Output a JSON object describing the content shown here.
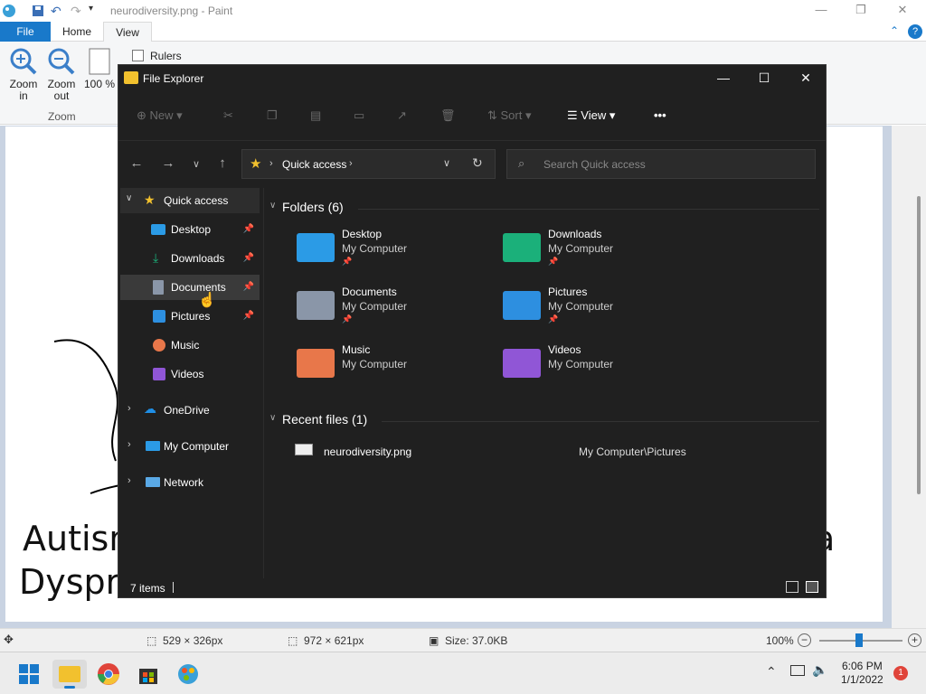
{
  "paint": {
    "title": "neurodiversity.png - Paint",
    "tabs": [
      "File",
      "Home",
      "View"
    ],
    "ribbon": {
      "zoom_in": "Zoom in",
      "zoom_out": "Zoom out",
      "hundred": "100 %",
      "rulers": "Rulers",
      "group_zoom": "Zoom"
    },
    "canvas_text_1": "Autism",
    "canvas_text_2": "Dyspra",
    "canvas_text_3": "a",
    "status": {
      "selection": "529 × 326px",
      "image_size": "972 × 621px",
      "file_size": "Size: 37.0KB",
      "zoom": "100%"
    }
  },
  "explorer": {
    "title": "File Explorer",
    "command_bar": {
      "new": "New",
      "sort": "Sort",
      "view": "View",
      "more": "•••"
    },
    "address": "Quick access",
    "search_placeholder": "Search Quick access",
    "sidebar": [
      {
        "label": "Quick access",
        "icon": "star-icon"
      },
      {
        "label": "Desktop",
        "icon": "desktop-icon"
      },
      {
        "label": "Downloads",
        "icon": "download-icon"
      },
      {
        "label": "Documents",
        "icon": "document-icon"
      },
      {
        "label": "Pictures",
        "icon": "pictures-icon"
      },
      {
        "label": "Music",
        "icon": "music-icon"
      },
      {
        "label": "Videos",
        "icon": "videos-icon"
      },
      {
        "label": "OneDrive",
        "icon": "cloud-icon"
      },
      {
        "label": "My Computer",
        "icon": "computer-icon"
      },
      {
        "label": "Network",
        "icon": "network-icon"
      }
    ],
    "folders_header": "Folders (6)",
    "folders": [
      {
        "name": "Desktop",
        "sub": "My Computer",
        "color": "#2b9be6"
      },
      {
        "name": "Downloads",
        "sub": "My Computer",
        "color": "#1bb07a"
      },
      {
        "name": "Documents",
        "sub": "My Computer",
        "color": "#8a96a8"
      },
      {
        "name": "Pictures",
        "sub": "My Computer",
        "color": "#2d8fe0"
      },
      {
        "name": "Music",
        "sub": "My Computer",
        "color": "#e8774a"
      },
      {
        "name": "Videos",
        "sub": "My Computer",
        "color": "#9056d6"
      }
    ],
    "recent_header": "Recent files (1)",
    "recent": [
      {
        "name": "neurodiversity.png",
        "path": "My Computer\\Pictures"
      }
    ],
    "status": "7 items"
  },
  "taskbar": {
    "time": "6:06 PM",
    "date": "1/1/2022",
    "notifications": "1"
  }
}
